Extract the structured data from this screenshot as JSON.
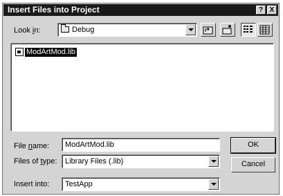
{
  "window": {
    "title": "Insert Files into Project",
    "help_label": "?",
    "close_label": "X"
  },
  "look_in": {
    "label_prefix": "Look ",
    "label_accel": "i",
    "label_suffix": "n:",
    "value": "Debug"
  },
  "toolbar": {
    "icons": [
      "up-folder-icon",
      "new-folder-icon",
      "list-view-icon",
      "details-view-icon"
    ]
  },
  "files": [
    {
      "name": "ModArtMod.lib",
      "icon": "library-file-icon",
      "selected": true
    }
  ],
  "file_name": {
    "label_prefix": "File ",
    "label_accel": "n",
    "label_suffix": "ame:",
    "value": "ModArtMod.lib"
  },
  "file_type": {
    "label_prefix": "Files of ",
    "label_accel": "t",
    "label_suffix": "ype:",
    "value": "Library Files (.lib)"
  },
  "insert_into": {
    "label": "Insert into:",
    "value": "TestApp"
  },
  "buttons": {
    "ok": "OK",
    "cancel": "Cancel"
  }
}
